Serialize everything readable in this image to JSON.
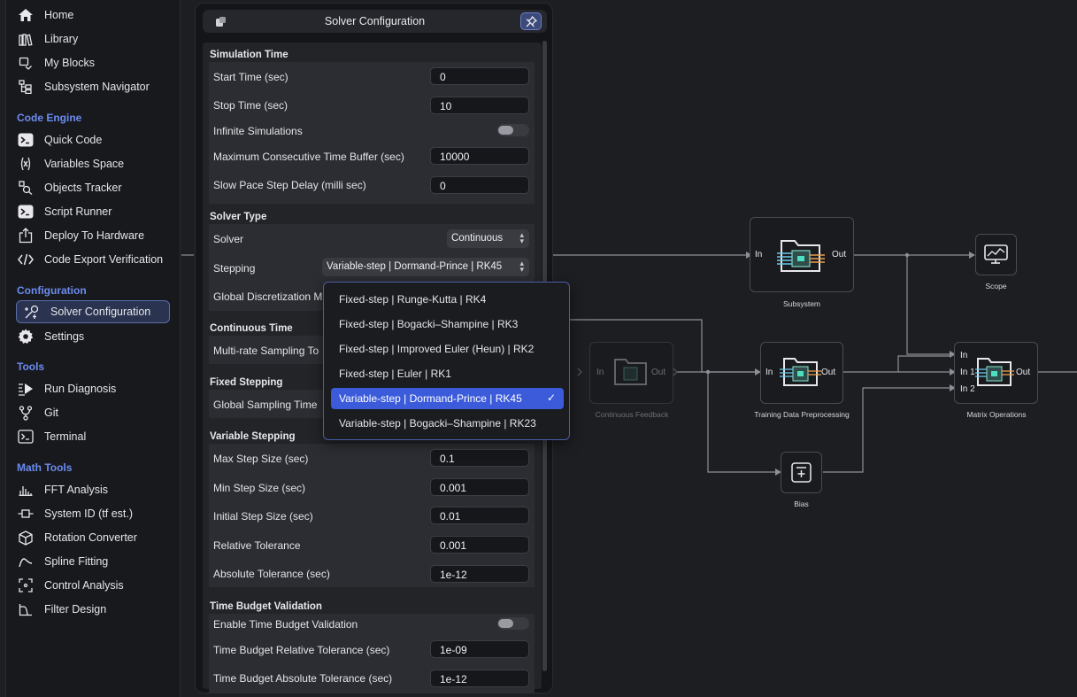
{
  "sidebar": {
    "top_items": [
      {
        "label": "Home",
        "icon": "home-icon"
      },
      {
        "label": "Library",
        "icon": "library-icon"
      },
      {
        "label": "My Blocks",
        "icon": "blocks-icon"
      },
      {
        "label": "Subsystem Navigator",
        "icon": "tree-icon"
      }
    ],
    "sections": [
      {
        "title": "Code Engine",
        "items": [
          {
            "label": "Quick Code",
            "icon": "terminal-icon"
          },
          {
            "label": "Variables Space",
            "icon": "variables-icon"
          },
          {
            "label": "Objects Tracker",
            "icon": "objects-icon"
          },
          {
            "label": "Script Runner",
            "icon": "terminal-icon"
          },
          {
            "label": "Deploy To Hardware",
            "icon": "deploy-icon"
          },
          {
            "label": "Code Export Verification",
            "icon": "code-icon"
          }
        ]
      },
      {
        "title": "Configuration",
        "items": [
          {
            "label": "Solver Configuration",
            "icon": "solver-icon",
            "active": true
          },
          {
            "label": "Settings",
            "icon": "gear-icon"
          }
        ]
      },
      {
        "title": "Tools",
        "items": [
          {
            "label": "Run Diagnosis",
            "icon": "diagnosis-icon"
          },
          {
            "label": "Git",
            "icon": "git-icon"
          },
          {
            "label": "Terminal",
            "icon": "terminal-icon"
          }
        ]
      },
      {
        "title": "Math Tools",
        "items": [
          {
            "label": "FFT Analysis",
            "icon": "fft-icon"
          },
          {
            "label": "System ID (tf est.)",
            "icon": "system-id-icon"
          },
          {
            "label": "Rotation Converter",
            "icon": "cube-icon"
          },
          {
            "label": "Spline Fitting",
            "icon": "spline-icon"
          },
          {
            "label": "Control Analysis",
            "icon": "control-icon"
          },
          {
            "label": "Filter Design",
            "icon": "filter-icon"
          }
        ]
      }
    ]
  },
  "panel": {
    "title": "Solver Configuration",
    "simulation_time": {
      "heading": "Simulation Time",
      "start_label": "Start Time (sec)",
      "start_value": "0",
      "stop_label": "Stop Time (sec)",
      "stop_value": "10",
      "infinite_label": "Infinite Simulations",
      "buffer_label": "Maximum Consecutive Time Buffer (sec)",
      "buffer_value": "10000",
      "slow_label": "Slow Pace Step Delay (milli sec)",
      "slow_value": "0"
    },
    "solver_type": {
      "heading": "Solver Type",
      "solver_label": "Solver",
      "solver_value": "Continuous",
      "stepping_label": "Stepping",
      "stepping_value": "Variable-step | Dormand-Prince | RK45",
      "global_disc_label": "Global Discretization M"
    },
    "continuous_time": {
      "heading": "Continuous Time",
      "multirate_label": "Multi-rate Sampling To"
    },
    "fixed_stepping": {
      "heading": "Fixed Stepping",
      "global_sampling_label": "Global Sampling Time"
    },
    "variable_stepping": {
      "heading": "Variable Stepping",
      "max_label": "Max Step Size (sec)",
      "max_value": "0.1",
      "min_label": "Min Step Size (sec)",
      "min_value": "0.001",
      "initial_label": "Initial Step Size (sec)",
      "initial_value": "0.01",
      "reltol_label": "Relative Tolerance",
      "reltol_value": "0.001",
      "abstol_label": "Absolute Tolerance (sec)",
      "abstol_value": "1e-12"
    },
    "time_budget": {
      "heading": "Time Budget Validation",
      "enable_label": "Enable Time Budget Validation",
      "rel_label": "Time Budget Relative Tolerance (sec)",
      "rel_value": "1e-09",
      "abs_label": "Time Budget Absolute Tolerance (sec)",
      "abs_value": "1e-12"
    }
  },
  "dropdown": {
    "options": [
      "Fixed-step | Runge-Kutta | RK4",
      "Fixed-step | Bogacki–Shampine | RK3",
      "Fixed-step | Improved Euler (Heun) | RK2",
      "Fixed-step | Euler | RK1",
      "Variable-step | Dormand-Prince | RK45",
      "Variable-step | Bogacki–Shampine | RK23"
    ],
    "selected_index": 4,
    "check": "✓"
  },
  "graph": {
    "subsystem": {
      "label": "Subsystem",
      "in": "In",
      "out": "Out"
    },
    "scope": {
      "label": "Scope"
    },
    "continuous_feedback": {
      "label": "Continuous Feedback",
      "in": "In",
      "out": "Out"
    },
    "training": {
      "label": "Training Data Preprocessing",
      "in": "In",
      "out": "Out"
    },
    "matrix": {
      "label": "Matrix Operations",
      "in": "In",
      "in1": "In 1",
      "in2": "In 2",
      "out": "Out"
    },
    "bias": {
      "label": "Bias"
    }
  },
  "colors": {
    "accent": "#3b5bdb",
    "section": "#6b8cf0",
    "wire": "#9a9ba2"
  }
}
